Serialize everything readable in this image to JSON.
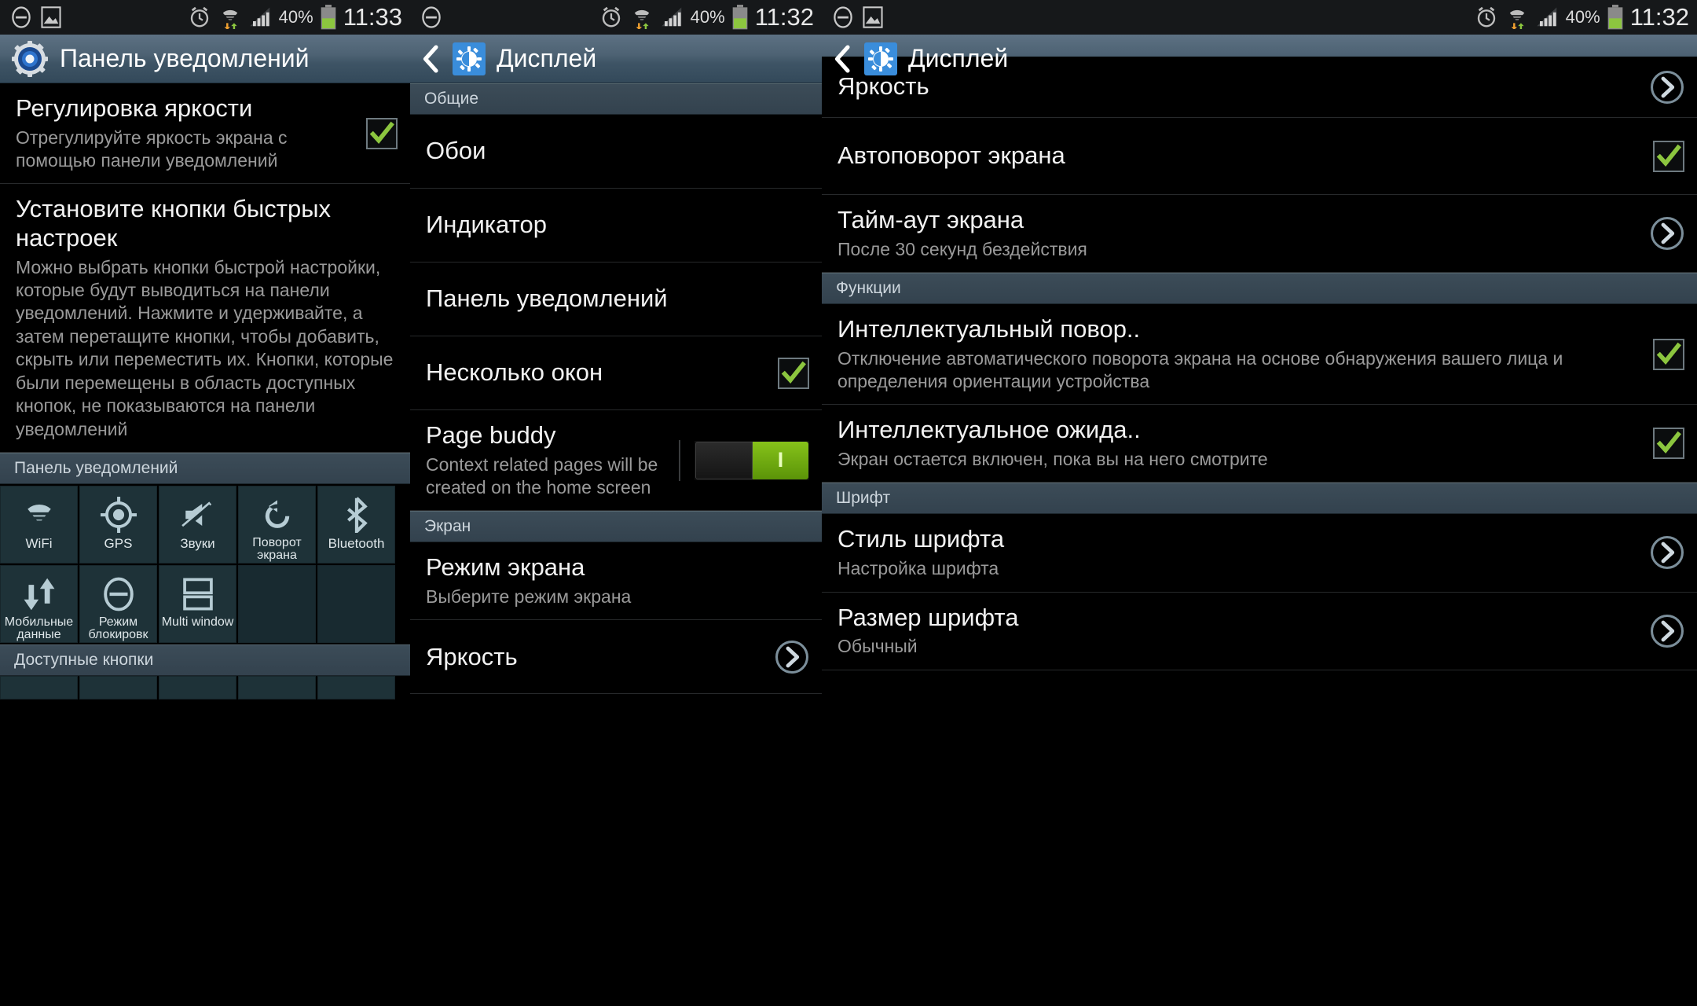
{
  "statusbar": {
    "icons": [
      "mute-icon",
      "image-icon",
      "alarm-icon",
      "wifi-icon",
      "data-transfer-icon",
      "signal-icon"
    ],
    "battery_pct": "40%",
    "time_panel1": "11:33",
    "time_panel2": "11:32",
    "time_panel3": "11:32"
  },
  "panel1": {
    "title": "Панель уведомлений",
    "title_icon": "settings-gear-icon",
    "rows": [
      {
        "title": "Регулировка яркости",
        "sub": "Отрегулируйте яркость экрана с помощью панели уведомлений",
        "checked": true
      },
      {
        "title": "Установите кнопки быстрых настроек",
        "sub": "Можно выбрать кнопки быстрой настройки, которые будут выводиться на панели уведомлений. Нажмите и удерживайте, а затем перетащите кнопки, чтобы добавить, скрыть или переместить их. Кнопки, которые были перемещены в область доступных кнопок, не показываются на панели уведомлений",
        "checked": false
      }
    ],
    "section_notification_panel": "Панель уведомлений",
    "section_available_buttons": "Доступные кнопки",
    "tiles": [
      {
        "label": "WiFi",
        "icon": "wifi-icon"
      },
      {
        "label": "GPS",
        "icon": "gps-icon"
      },
      {
        "label": "Звуки",
        "icon": "sound-mute-icon"
      },
      {
        "label": "Поворот экрана",
        "icon": "rotate-icon"
      },
      {
        "label": "Bluetooth",
        "icon": "bluetooth-icon"
      },
      {
        "label": "Мобильные данные",
        "icon": "mobile-data-icon"
      },
      {
        "label": "Режим блокировк",
        "icon": "blocking-mode-icon"
      },
      {
        "label": "Multi window",
        "icon": "multi-window-icon"
      },
      {
        "label": "",
        "icon": ""
      },
      {
        "label": "",
        "icon": ""
      }
    ]
  },
  "panel2": {
    "title": "Дисплей",
    "back_icon": "back-chevron-icon",
    "title_icon": "display-settings-icon",
    "section_general": "Общие",
    "section_screen": "Экран",
    "rows": [
      {
        "title": "Обои",
        "sub": "",
        "accessory": "none"
      },
      {
        "title": "Индикатор",
        "sub": "",
        "accessory": "none"
      },
      {
        "title": "Панель уведомлений",
        "sub": "",
        "accessory": "none"
      },
      {
        "title": "Несколько окон",
        "sub": "",
        "accessory": "checkbox",
        "checked": true
      },
      {
        "title": "Page buddy",
        "sub": "Context related pages will be created on the home screen",
        "accessory": "toggle",
        "toggle_on": true
      },
      {
        "title": "Режим экрана",
        "sub": "Выберите режим экрана",
        "accessory": "none"
      },
      {
        "title": "Яркость",
        "sub": "",
        "accessory": "chevron"
      }
    ]
  },
  "panel3": {
    "title": "Дисплей",
    "back_icon": "back-chevron-icon",
    "title_icon": "display-settings-icon",
    "section_functions": "Функции",
    "section_font": "Шрифт",
    "rows": [
      {
        "title": "Яркость",
        "sub": "",
        "accessory": "chevron"
      },
      {
        "title": "Автоповорот экрана",
        "sub": "",
        "accessory": "checkbox",
        "checked": true
      },
      {
        "title": "Тайм-аут экрана",
        "sub": "После 30 секунд бездействия",
        "accessory": "chevron"
      },
      {
        "title": "Интеллектуальный повор..",
        "sub": "Отключение автоматического поворота экрана на основе обнаружения вашего лица и определения ориентации устройства",
        "accessory": "checkbox",
        "checked": true
      },
      {
        "title": "Интеллектуальное ожида..",
        "sub": "Экран остается включен, пока вы на него смотрите",
        "accessory": "checkbox",
        "checked": true
      },
      {
        "title": "Стиль шрифта",
        "sub": "Настройка шрифта",
        "accessory": "chevron"
      },
      {
        "title": "Размер шрифта",
        "sub": "Обычный",
        "accessory": "chevron"
      }
    ]
  },
  "colors": {
    "accent_green": "#8cc63f",
    "titlebar_blue": "#4d6273",
    "tile_bg": "#1e3238",
    "icon_blue": "#3a8ddb"
  }
}
